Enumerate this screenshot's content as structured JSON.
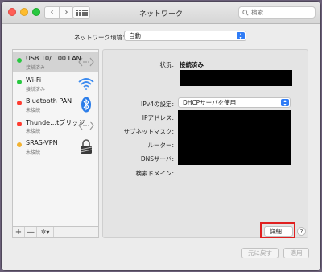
{
  "window": {
    "title": "ネットワーク"
  },
  "search": {
    "placeholder": "検索"
  },
  "location": {
    "label": "ネットワーク環境：",
    "value": "自動"
  },
  "services": [
    {
      "name": "USB 10/…00 LAN",
      "status": "接続済み",
      "color": "#28c840",
      "icon": "ethernet-icon"
    },
    {
      "name": "Wi-Fi",
      "status": "接続済み",
      "color": "#28c840",
      "icon": "wifi-icon"
    },
    {
      "name": "Bluetooth PAN",
      "status": "未接続",
      "color": "#ff3b30",
      "icon": "bluetooth-icon"
    },
    {
      "name": "Thunde…tブリッジ",
      "status": "未接続",
      "color": "#ff3b30",
      "icon": "thunderbolt-bridge-icon"
    },
    {
      "name": "SRAS-VPN",
      "status": "未接続",
      "color": "#f2b230",
      "icon": "vpn-lock-icon"
    }
  ],
  "sidebar_controls": {
    "add": "+",
    "remove": "—",
    "gear": "✲▾"
  },
  "detail": {
    "status_label": "状況:",
    "status_value": "接続済み",
    "ipv4_label": "IPv4の設定:",
    "ipv4_value": "DHCPサーバを使用",
    "ip_label": "IPアドレス:",
    "subnet_label": "サブネットマスク:",
    "router_label": "ルーター:",
    "dns_label": "DNSサーバ:",
    "search_domain_label": "検索ドメイン:",
    "advanced_button": "詳細...",
    "help": "?"
  },
  "footer": {
    "revert": "元に戻す",
    "apply": "適用"
  },
  "colors": {
    "accent": "#2f7cf6",
    "highlight": "#e02020"
  }
}
